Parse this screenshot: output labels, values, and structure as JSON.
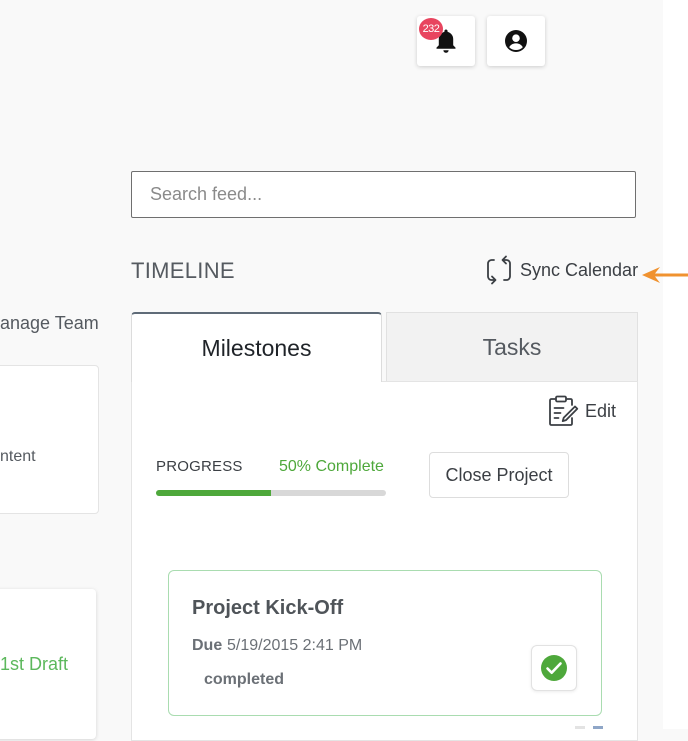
{
  "header": {
    "notifications": {
      "count": "232",
      "icon": "bell-icon"
    },
    "profile": {
      "icon": "user-circle-icon"
    }
  },
  "search": {
    "placeholder": "Search feed...",
    "value": ""
  },
  "timeline": {
    "title": "TIMELINE",
    "sync_label": "Sync Calendar",
    "sync_icon": "refresh-icon",
    "tabs": [
      {
        "label": "Milestones",
        "active": true
      },
      {
        "label": "Tasks",
        "active": false
      }
    ],
    "edit_label": "Edit",
    "edit_icon": "clipboard-edit-icon",
    "progress": {
      "label": "PROGRESS",
      "percent_text": "50% Complete",
      "value": 0.5
    },
    "close_project_label": "Close Project",
    "milestones": [
      {
        "title": "Project Kick-Off",
        "due_label": "Due",
        "due_value": "5/19/2015 2:41 PM",
        "status": "completed",
        "status_icon": "check-circle-icon"
      }
    ]
  },
  "left_column": {
    "manage_team_label": "anage Team",
    "card1_text": "ntent",
    "card2_text": "1st Draft"
  },
  "colors": {
    "accent_green": "#4ea83b",
    "badge_red": "#e8455f",
    "arrow_orange": "#f0922f",
    "card_border_green": "#a9dcb0"
  }
}
